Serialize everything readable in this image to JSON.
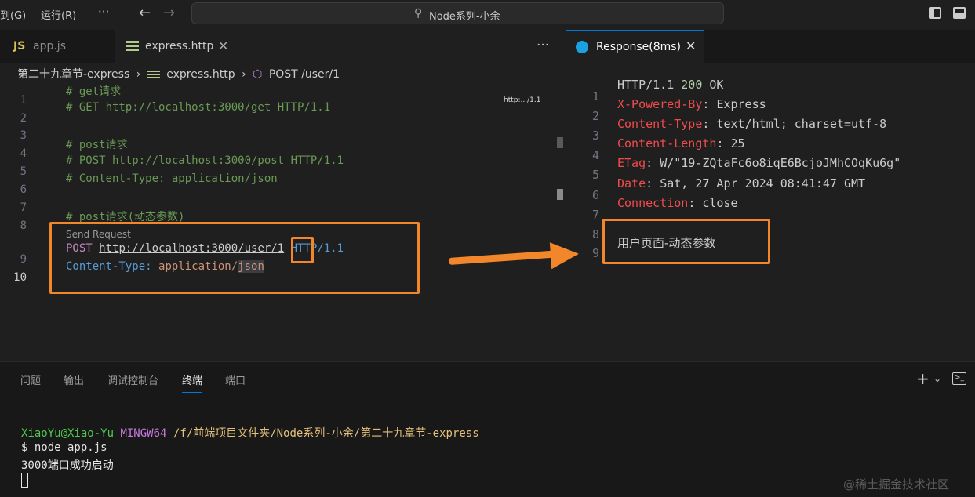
{
  "titlebar": {
    "menu_goto": "到(G)",
    "menu_run": "运行(R)",
    "menu_more": "···",
    "back": "←",
    "forward": "→",
    "search_icon": "⚲",
    "title": "Node系列-小余"
  },
  "left_tabs": {
    "app_icon": "JS",
    "app_label": "app.js",
    "http_label": "express.http",
    "close": "✕",
    "more": "···"
  },
  "breadcrumb": {
    "folder": "第二十九章节-express",
    "sep": "›",
    "file": "express.http",
    "symbol_icon": "⬡",
    "symbol": "POST /user/1"
  },
  "editor_left": {
    "codelens": "Send Request",
    "minimap_text": "http:.../1.1",
    "lines": {
      "l1": "# get请求",
      "l2": "# GET http://localhost:3000/get HTTP/1.1",
      "l4": "# post请求",
      "l5": "# POST http://localhost:3000/post HTTP/1.1",
      "l6": "# Content-Type: application/json",
      "l8": "# post请求(动态参数)",
      "l9_method": "POST",
      "l9_url": "http://localhost:3000/user/",
      "l9_id": "1",
      "l9_ver": "HTTP/1.1",
      "l10_key": "Content-Type:",
      "l10_val": "application/",
      "l10_json": "json"
    },
    "line_numbers": [
      "1",
      "2",
      "3",
      "4",
      "5",
      "6",
      "7",
      "8",
      "9",
      "10"
    ]
  },
  "right_tab": {
    "label": "Response(8ms)",
    "close": "✕"
  },
  "response": {
    "line_numbers": [
      "1",
      "2",
      "3",
      "4",
      "5",
      "6",
      "7",
      "8",
      "9"
    ],
    "status_proto": "HTTP/1.1",
    "status_code": "200",
    "status_text": "OK",
    "h1_name": "X-Powered-By",
    "h1_val": "Express",
    "h2_name": "Content-Type",
    "h2_val": "text/html; charset=utf-8",
    "h3_name": "Content-Length",
    "h3_val": "25",
    "h4_name": "ETag",
    "h4_val": "W/\"19-ZQtaFc6o8iqE6BcjoJMhCOqKu6g\"",
    "h5_name": "Date",
    "h5_val": "Sat, 27 Apr 2024 08:41:47 GMT",
    "h6_name": "Connection",
    "h6_val": "close",
    "body": "用户页面-动态参数"
  },
  "panel": {
    "tabs": [
      "问题",
      "输出",
      "调试控制台",
      "终端",
      "端口"
    ],
    "plus": "+",
    "chevron": "⌄",
    "terminal_icon": ">_"
  },
  "terminal": {
    "user": "XiaoYu@Xiao-Yu",
    "sys": "MINGW64",
    "path": "/f/前端项目文件夹/Node系列-小余/第二十九章节-express",
    "cmd": "$ node app.js",
    "out": "3000端口成功启动"
  },
  "watermark": "@稀土掘金技术社区",
  "colors": {
    "annotation": "#f2862b",
    "accent": "#0078d4"
  }
}
